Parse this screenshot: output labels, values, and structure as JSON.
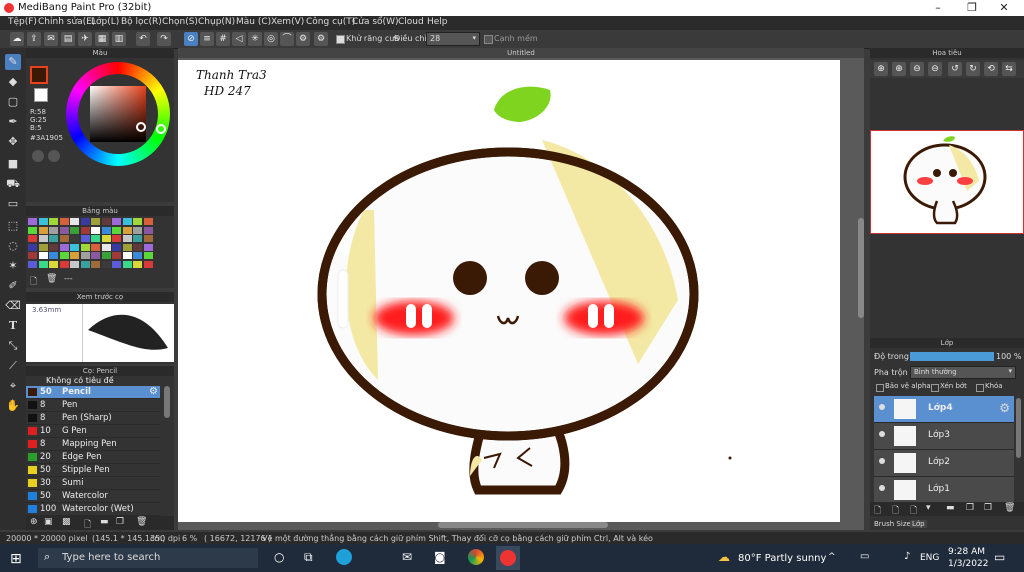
{
  "window": {
    "title": "MediBang Paint Pro (32bit)"
  },
  "menu": [
    "Tệp(F)",
    "Chỉnh sửa(E)",
    "Lớp(L)",
    "Bộ lọc(R)",
    "Chọn(S)",
    "Chụp(N)",
    "Màu (C)",
    "Xem(V)",
    "Công cụ(T)",
    "Cửa sổ(W)",
    "Cloud",
    "Help"
  ],
  "toolbar": {
    "antialias_label": "Khử răng cưa",
    "adjust_label": "Điều chỉnh",
    "adjust_value": "28",
    "edge_label": "Cạnh mềm"
  },
  "color_panel": {
    "title": "Màu",
    "r": "R:58",
    "g": "G:25",
    "b": "B:5",
    "hex": "#3A1905",
    "colors": {
      "fg": "#3a1905",
      "accent": "#e8411c"
    }
  },
  "palette": {
    "title": "Bảng màu",
    "more": "---"
  },
  "preview": {
    "title": "Xem trước cọ",
    "size": "3.63mm"
  },
  "brush": {
    "title": "Cọ: Pencil",
    "top_item": "Không có tiêu đề",
    "items": [
      {
        "size": "50",
        "name": "Pencil",
        "color": "#3a1905"
      },
      {
        "size": "8",
        "name": "Pen",
        "color": "#111111"
      },
      {
        "size": "8",
        "name": "Pen (Sharp)",
        "color": "#111111"
      },
      {
        "size": "10",
        "name": "G Pen",
        "color": "#e02020"
      },
      {
        "size": "8",
        "name": "Mapping Pen",
        "color": "#e02020"
      },
      {
        "size": "20",
        "name": "Edge Pen",
        "color": "#2aa02a"
      },
      {
        "size": "50",
        "name": "Stipple Pen",
        "color": "#e8d020"
      },
      {
        "size": "30",
        "name": "Sumi",
        "color": "#e8d020"
      },
      {
        "size": "50",
        "name": "Watercolor",
        "color": "#2080e0"
      },
      {
        "size": "100",
        "name": "Watercolor (Wet)",
        "color": "#2080e0"
      }
    ]
  },
  "canvas": {
    "tab": "Untitled",
    "handwriting_line1": "Thanh Tra3",
    "handwriting_line2": "HD 247"
  },
  "navigator": {
    "title": "Hoa tiêu"
  },
  "layer_panel": {
    "title": "Lớp",
    "opacity_label": "Độ trong",
    "opacity_value": "100 %",
    "opacity": 1.0,
    "blend_label": "Pha trộn",
    "blend_value": "Bình thường",
    "protect_alpha": "Bảo vệ alpha",
    "clipping": "Xén bớt",
    "lock": "Khóa",
    "layers": [
      "Lớp4",
      "Lớp3",
      "Lớp2",
      "Lớp1"
    ],
    "bottom_tabs": [
      "Brush Size",
      "Lớp"
    ]
  },
  "status": {
    "size": "20000 * 20000 pixel",
    "cm": "(145.1 * 145.1cm)",
    "dpi": "350 dpi",
    "zoom": "6 %",
    "coords": "( 16672, 12176 )",
    "hint": "Vẽ một đường thẳng bằng cách giữ phím Shift, Thay đổi cỡ cọ bằng cách giữ phím Ctrl, Alt và kéo"
  },
  "taskbar": {
    "search_placeholder": "Type here to search",
    "weather": "80°F  Partly sunny",
    "lang": "ENG",
    "time": "9:28 AM",
    "date": "1/3/2022"
  }
}
